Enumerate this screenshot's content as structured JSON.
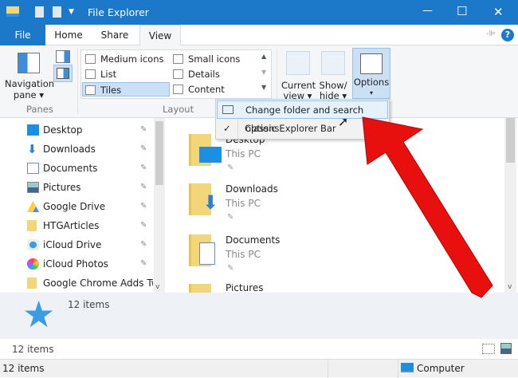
{
  "window": {
    "title": "File Explorer",
    "minimize": "—",
    "maximize": "☐",
    "close": "✕"
  },
  "tabs": [
    "File",
    "Home",
    "Share",
    "View"
  ],
  "help": "?",
  "ribbon": {
    "panes": {
      "nav_label_1": "Navigation",
      "nav_label_2": "pane ▾",
      "group": "Panes"
    },
    "layout": {
      "items": [
        "Medium icons",
        "Small icons",
        "List",
        "Details",
        "Tiles",
        "Content"
      ],
      "group": "Layout",
      "selected": "Tiles"
    },
    "current_view": {
      "l1": "Current",
      "l2": "view ▾"
    },
    "show_hide": {
      "l1": "Show/",
      "l2": "hide ▾"
    },
    "options": {
      "l1": "Options",
      "l2": "▾"
    }
  },
  "menu": {
    "items": [
      {
        "label": "Change folder and search options",
        "checked": false
      },
      {
        "label": "Classic Explorer Bar",
        "checked": true
      }
    ],
    "check": "✓"
  },
  "nav": {
    "items": [
      "Desktop",
      "Downloads",
      "Documents",
      "Pictures",
      "Google Drive",
      "HTGArticles",
      "iCloud Drive",
      "iCloud Photos",
      "Google Chrome Adds Two"
    ]
  },
  "content": {
    "tiles": [
      {
        "name": "Desktop",
        "sub": "This PC"
      },
      {
        "name": "Downloads",
        "sub": "This PC"
      },
      {
        "name": "Documents",
        "sub": "This PC"
      },
      {
        "name": "Pictures",
        "sub": ""
      }
    ]
  },
  "details": {
    "count": "12 items"
  },
  "status": {
    "count": "12 items",
    "bottom_count": "12 items",
    "location": "Computer"
  },
  "colors": {
    "accent": "#1c78c9",
    "arrow": "#e8100f"
  }
}
